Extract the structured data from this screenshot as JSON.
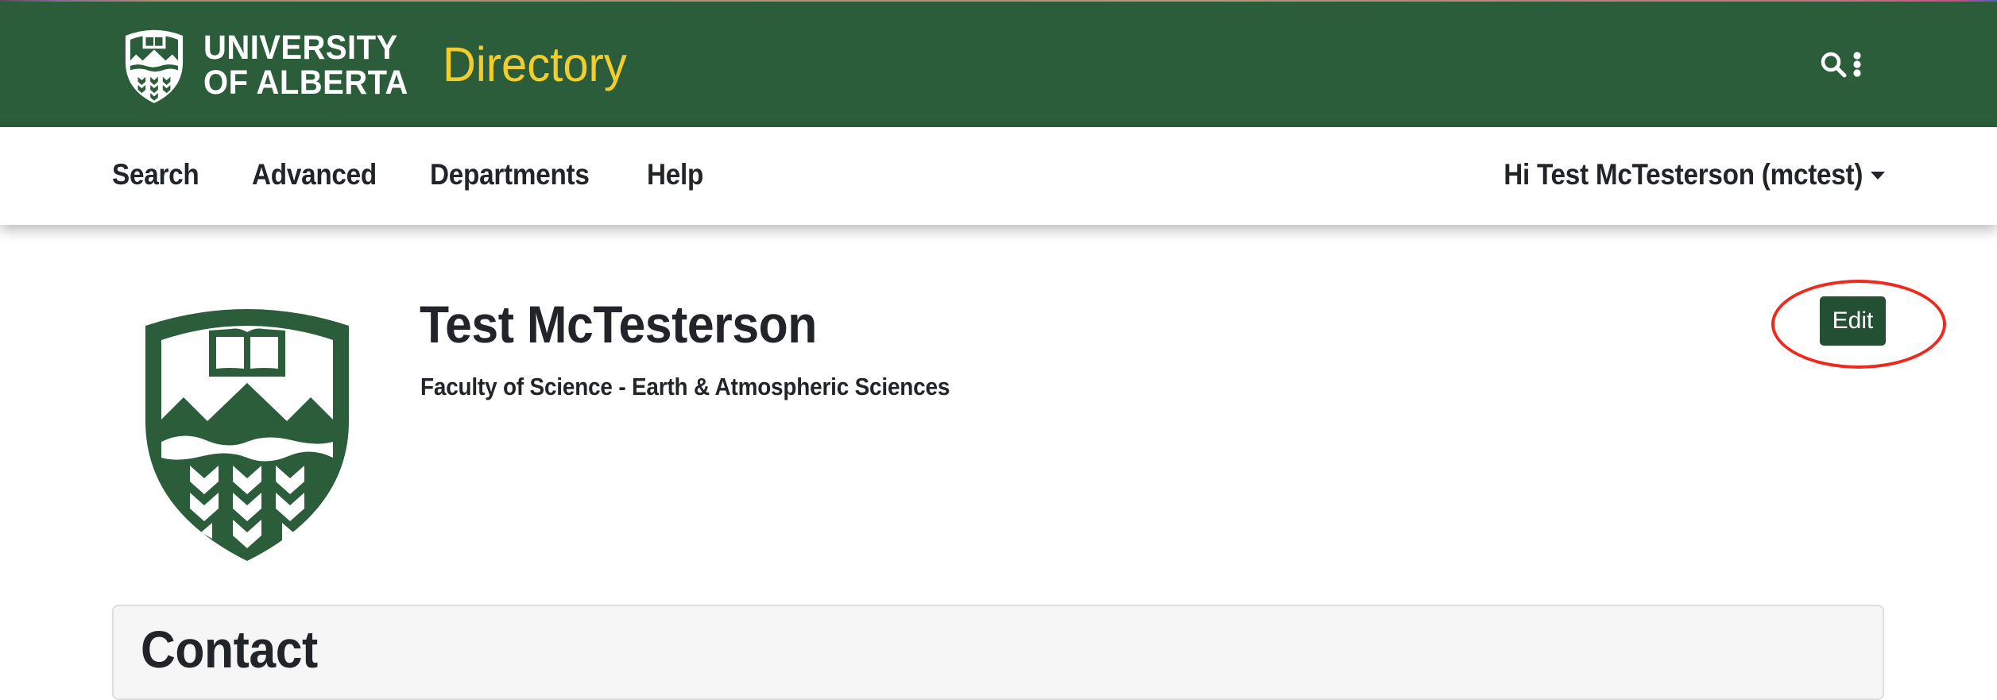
{
  "header": {
    "brand_line1": "UNIVERSITY",
    "brand_line2": "OF ALBERTA",
    "app_title": "Directory",
    "icons": [
      "university-shield-logo-icon",
      "search-icon",
      "kebab-menu-icon"
    ],
    "colors": {
      "header_bg": "#2b5d3a",
      "title_yellow": "#f2cd2b"
    }
  },
  "nav": {
    "items": [
      {
        "label": "Search"
      },
      {
        "label": "Advanced"
      },
      {
        "label": "Departments"
      },
      {
        "label": "Help"
      }
    ],
    "user_menu": {
      "label": "Hi Test McTesterson (mctest)",
      "icon": "caret-down-icon"
    }
  },
  "profile": {
    "name": "Test McTesterson",
    "department": "Faculty of Science - Earth & Atmospheric Sciences",
    "avatar_icon": "university-shield-icon",
    "edit_label": "Edit",
    "colors": {
      "edit_bg": "#234f32",
      "highlight": "#ee2a1e"
    }
  },
  "contact": {
    "title": "Contact"
  }
}
